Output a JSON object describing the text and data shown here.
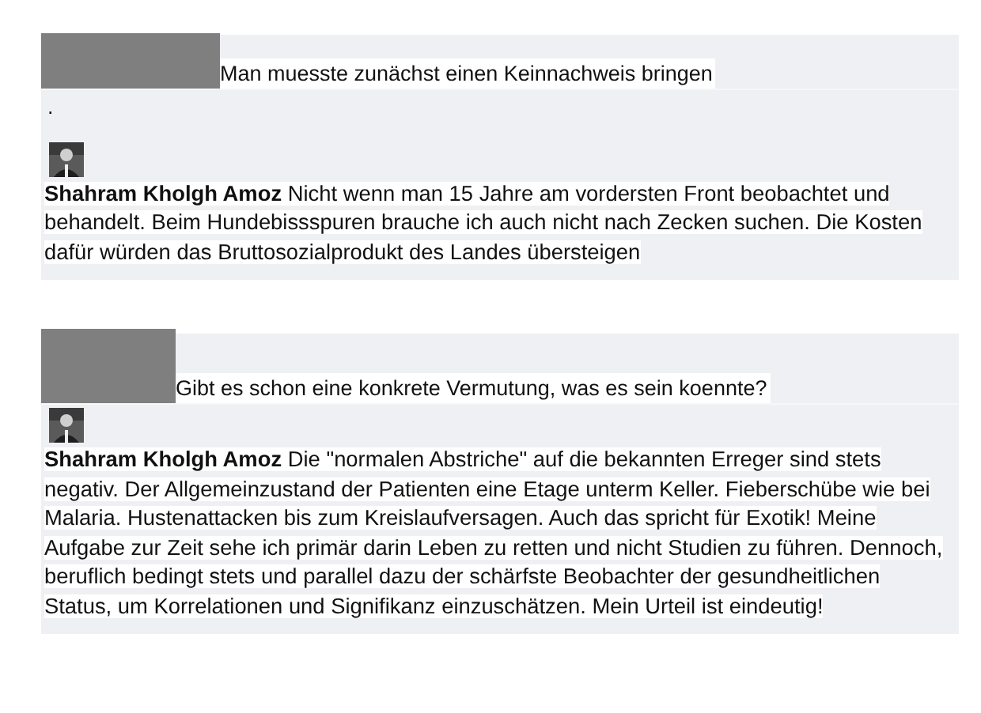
{
  "threads": [
    {
      "comment": "Man muesste zunächst einen Keinnachweis bringen",
      "separator": ".",
      "reply": {
        "author": "Shahram Kholgh Amoz",
        "text": "Nicht wenn man 15 Jahre am vordersten Front beobachtet und behandelt. Beim Hundebissspuren brauche ich auch nicht nach Zecken suchen. Die Kosten dafür würden das Bruttosozialprodukt des Landes übersteigen"
      }
    },
    {
      "comment": "Gibt es schon eine konkrete Vermutung, was es sein koennte?",
      "reply": {
        "author": "Shahram Kholgh Amoz",
        "text": "Die \"normalen Abstriche\" auf die bekannten Erreger sind stets negativ. Der Allgemeinzustand der Patienten eine Etage unterm Keller. Fieberschübe wie bei Malaria. Hustenattacken bis zum Kreislaufversagen. Auch das spricht für Exotik! Meine Aufgabe zur Zeit sehe ich primär darin Leben zu retten und nicht Studien zu führen. Dennoch, beruflich bedingt stets und parallel dazu der schärfste Beobachter der gesundheitlichen Status, um Korrelationen und Signifikanz einzuschätzen. Mein Urteil ist eindeutig!"
      }
    }
  ]
}
